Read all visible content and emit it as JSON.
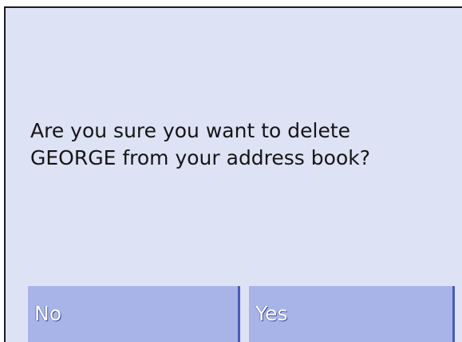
{
  "dialog": {
    "message": "Are you sure you want to delete\nGEORGE from your address book?"
  },
  "buttons": {
    "no_label": "No",
    "yes_label": "Yes"
  },
  "colors": {
    "dialog_background": "#dde2f5",
    "button_background": "#a8b4e8",
    "button_edge": "#4a5cb6",
    "text": "#151515"
  }
}
